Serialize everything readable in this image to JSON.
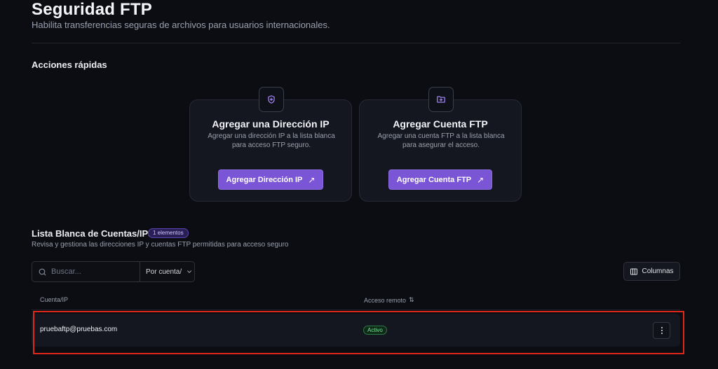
{
  "header": {
    "title": "Seguridad FTP",
    "subtitle": "Habilita transferencias seguras de archivos para usuarios internacionales."
  },
  "quick_actions": {
    "title": "Acciones rápidas",
    "cards": [
      {
        "icon": "shield-plus-icon",
        "title": "Agregar una Dirección IP",
        "description": "Agregar una dirección IP a la lista blanca para acceso FTP seguro.",
        "button_label": "Agregar Dirección IP"
      },
      {
        "icon": "folder-plus-icon",
        "title": "Agregar Cuenta FTP",
        "description": "Agregar una cuenta FTP a la lista blanca para asegurar el acceso.",
        "button_label": "Agregar Cuenta FTP"
      }
    ]
  },
  "whitelist": {
    "title": "Lista Blanca de Cuentas/IPs",
    "count_badge": "1 elementos",
    "subtitle": "Revisa y gestiona las direcciones IP y cuentas FTP permitidas para acceso seguro",
    "search": {
      "placeholder": "Buscar..."
    },
    "filter": {
      "selected": "Por cuenta/"
    },
    "columns_button": "Columnas",
    "columns": [
      "Cuenta/IP",
      "Acceso remoto"
    ],
    "rows": [
      {
        "account": "pruebaftp@pruebas.com",
        "status": "Activo"
      }
    ]
  },
  "colors": {
    "accent": "#7a55d6",
    "active_status": "#7ee09a",
    "highlight": "#e0271b"
  }
}
